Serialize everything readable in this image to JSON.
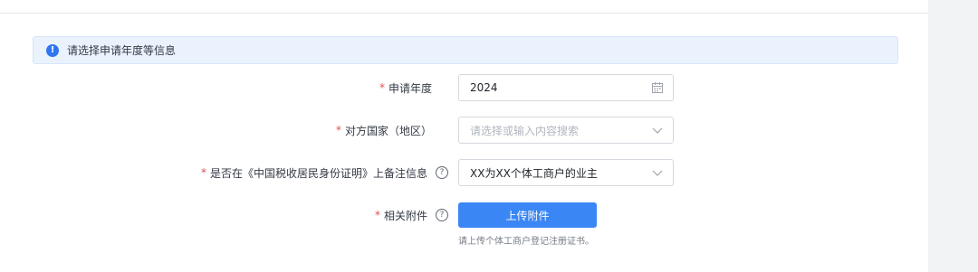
{
  "notice": {
    "text": "请选择申请年度等信息",
    "icon": "info-icon"
  },
  "form": {
    "year": {
      "label": "申请年度",
      "required_mark": "*",
      "value": "2024",
      "icon": "calendar-icon"
    },
    "country": {
      "label": "对方国家（地区）",
      "required_mark": "*",
      "placeholder": "请选择或输入内容搜索",
      "icon": "chevron-down-icon"
    },
    "remark": {
      "label": "是否在《中国税收居民身份证明》上备注信息",
      "required_mark": "*",
      "help": "?",
      "value": "XX为XX个体工商户的业主",
      "icon": "chevron-down-icon"
    },
    "attachment": {
      "label": "相关附件",
      "required_mark": "*",
      "help": "?",
      "button": "上传附件",
      "hint": "请上传个体工商户登记注册证书。"
    }
  },
  "colors": {
    "primary": "#3a86f4",
    "required": "#e34d4d",
    "notice_bg": "#eaf2fd"
  }
}
